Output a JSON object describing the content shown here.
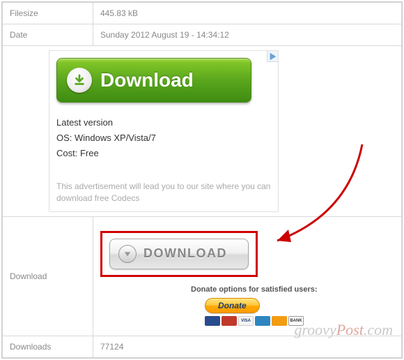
{
  "rows": {
    "filesize": {
      "label": "Filesize",
      "value": "445.83 kB"
    },
    "date": {
      "label": "Date",
      "value": "Sunday 2012 August 19 - 14:34:12"
    },
    "download": {
      "label": "Download"
    },
    "downloads": {
      "label": "Downloads",
      "value": "77124"
    }
  },
  "ad": {
    "button_text": "Download",
    "line1": "Latest version",
    "line2": "OS: Windows XP/Vista/7",
    "line3": "Cost: Free",
    "disclaimer": "This advertisement will lead you to our site where you can download free Codecs"
  },
  "real_download": {
    "button_text": "DOWNLOAD"
  },
  "donate": {
    "heading": "Donate options for satisfied users:",
    "button": "Donate"
  },
  "watermark": {
    "part1": "groovy",
    "part2": "Post",
    "part3": ".com"
  }
}
